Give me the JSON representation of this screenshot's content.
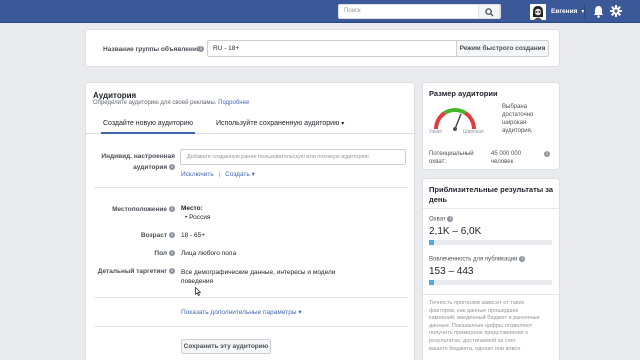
{
  "topbar": {
    "search_placeholder": "Поиск",
    "user_name": "Евгения",
    "icons": [
      "search-icon",
      "bell-icon",
      "gear-icon"
    ],
    "brand_color": "#3b5998"
  },
  "adset": {
    "name_label": "Название группы объявлений",
    "name_value": "RU - 18+",
    "quick_create_button": "Режим быстрого создания"
  },
  "audience": {
    "title": "Аудитория",
    "subtitle": "Определите аудиторию для своей рекламы.",
    "more_link": "Подробнее",
    "tabs": [
      {
        "label": "Создайте новую аудиторию",
        "active": true
      },
      {
        "label": "Используйте сохраненную аудиторию",
        "active": false
      }
    ],
    "custom_audience": {
      "label_line1": "Индивид. настроенная",
      "label_line2": "аудитория",
      "placeholder": "Добавьте созданную ранее пользовательскую или похожую аудиторию",
      "exclude_link": "Исключить",
      "separator": "|",
      "create_link": "Создать"
    },
    "location": {
      "label": "Местоположение",
      "heading": "Место:",
      "value": "Россия"
    },
    "age": {
      "label": "Возраст",
      "value": "18 - 65+"
    },
    "gender": {
      "label": "Пол",
      "value": "Лица любого пола"
    },
    "detailed": {
      "label": "Детальный таргетинг",
      "value_line1": "Все демографические данные, интересы и модели",
      "value_line2": "поведения"
    },
    "more_params_link": "Показать дополнительные параметры",
    "save_button": "Сохранить эту аудиторию"
  },
  "audience_size": {
    "title": "Размер аудитории",
    "gauge_left": "Узкая",
    "gauge_right": "Широкая",
    "gauge_level": 0.62,
    "desc_lines": [
      "Выбрана",
      "достаточно",
      "широкая",
      "аудитория."
    ],
    "reach_label_line1": "Потенциальный",
    "reach_label_line2": "охват:",
    "reach_value_line1": "45 000 000",
    "reach_value_line2": "человек"
  },
  "results": {
    "title_line1": "Приблизительные результаты за",
    "title_line2": "день",
    "reach_label": "Охват",
    "reach_value": "2,1K – 6,0K",
    "reach_level": 0.04,
    "engagement_label": "Вовлеченность для публикации",
    "engagement_value": "153 – 443",
    "engagement_level": 0.04,
    "note_lines": [
      "Точность прогнозов зависит от таких",
      "факторов, как данные прошедших",
      "кампаний, введенный бюджет и рыночные",
      "данные. Показанные цифры позволяют",
      "получить примерное представление о",
      "результатах, достигаемой за счет",
      "вашего бюджета, однако они вовсе"
    ]
  }
}
